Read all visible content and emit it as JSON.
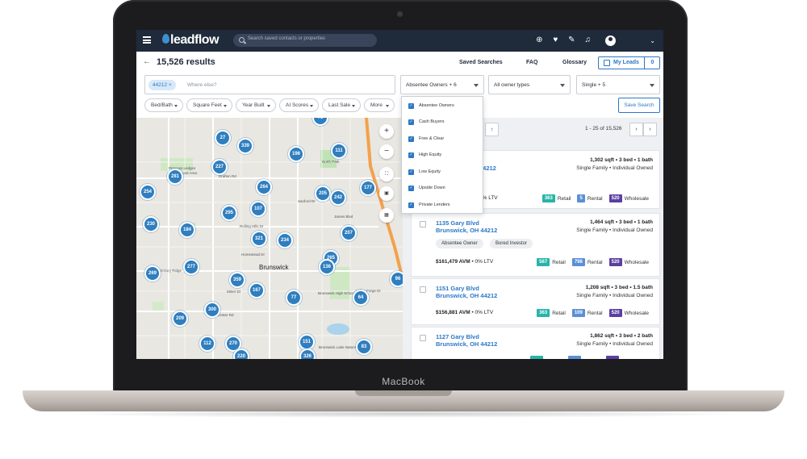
{
  "device": {
    "brand_label": "MacBook"
  },
  "nav": {
    "logo": "leadflow",
    "search_placeholder": "Search saved contacts or properties",
    "icons": [
      "plus-circle-icon",
      "heart-icon",
      "pin-icon",
      "bell-icon",
      "user-avatar-icon",
      "chevron-down-icon"
    ]
  },
  "header": {
    "results": "15,526 results",
    "links": [
      "Saved Searches",
      "FAQ",
      "Glossary"
    ],
    "my_leads": "My Leads",
    "my_leads_count": "0"
  },
  "filters": {
    "location_chip": "44212",
    "location_placeholder": "Where else?",
    "owner_select": "Absentee Owners + 6",
    "owner_type_select": "All owner types",
    "property_select": "Single + 5",
    "pills": [
      "Bed/Bath",
      "Square Feet",
      "Year Built",
      "AI Scores",
      "Last Sale",
      "More"
    ],
    "save_search": "Save Search"
  },
  "dropdown": {
    "items": [
      {
        "label": "Absentee Owners",
        "checked": true
      },
      {
        "label": "Cash Buyers",
        "checked": true
      },
      {
        "label": "Free & Clear",
        "checked": true
      },
      {
        "label": "High Equity",
        "checked": true
      },
      {
        "label": "Low Equity",
        "checked": true
      },
      {
        "label": "Upside Down",
        "checked": true
      },
      {
        "label": "Private Lenders",
        "checked": true
      }
    ]
  },
  "map": {
    "city": "Brunswick",
    "clusters": [
      "75",
      "27",
      "339",
      "196",
      "111",
      "281",
      "227",
      "254",
      "264",
      "205",
      "242",
      "177",
      "107",
      "295",
      "230",
      "184",
      "321",
      "234",
      "207",
      "277",
      "265",
      "136",
      "269",
      "359",
      "167",
      "77",
      "64",
      "96",
      "300",
      "209",
      "112",
      "270",
      "151",
      "83",
      "220",
      "326"
    ],
    "streets": [
      "Marks Rd",
      "Drafton Rd",
      "Princess Ledges",
      "Natural Area",
      "Sanford Dr",
      "Trails",
      "Rolling Hills Dr",
      "James Blvd",
      "Carpenter Rd",
      "Homestead Dr",
      "Center Rd",
      "Hickory Ridge",
      "Miner Dr",
      "Pearl Rd",
      "Valley Forge Dr",
      "Brunswick High School",
      "Brunswick Lake Nature Pres.",
      "North Park"
    ],
    "controls": [
      "zoom-in-icon",
      "zoom-out-icon",
      "expand-icon",
      "trash-icon",
      "layers-icon"
    ]
  },
  "list": {
    "page_range": "1 - 25 of 15,526",
    "cards": [
      {
        "address1": "",
        "address2": "44212",
        "specs": "1,302 sqft • 3 bed • 1 bath",
        "ptype": "Single Family • Individual Owned",
        "tags": [],
        "avm": "",
        "ltv": "0% LTV",
        "retail": "363",
        "retail_label": "Retail",
        "rental": "5",
        "rental_label": "Rental",
        "wholesale": "520",
        "wholesale_label": "Wholesale"
      },
      {
        "address1": "1135 Gary Blvd",
        "address2": "Brunswick, OH 44212",
        "specs": "1,464 sqft • 3 bed • 1 bath",
        "ptype": "Single Family • Individual Owned",
        "tags": [
          "Absentee Owner",
          "Bored Investor"
        ],
        "avm": "$161,479 AVM",
        "ltv": "• 0% LTV",
        "retail": "567",
        "retail_label": "Retail",
        "rental": "798",
        "rental_label": "Rental",
        "wholesale": "520",
        "wholesale_label": "Wholesale"
      },
      {
        "address1": "1151 Gary Blvd",
        "address2": "Brunswick, OH 44212",
        "specs": "1,208 sqft • 3 bed • 1.5 bath",
        "ptype": "Single Family • Individual Owned",
        "tags": [],
        "avm": "$156,881 AVM",
        "ltv": "• 0% LTV",
        "retail": "363",
        "retail_label": "Retail",
        "rental": "109",
        "rental_label": "Rental",
        "wholesale": "520",
        "wholesale_label": "Wholesale"
      },
      {
        "address1": "1127 Gary Blvd",
        "address2": "Brunswick, OH 44212",
        "specs": "1,862 sqft • 3 bed • 2 bath",
        "ptype": "Single Family • Individual Owned"
      }
    ]
  },
  "colors": {
    "nav_bg": "#1f2a3a",
    "accent": "#2c78c7",
    "cluster": "#2f7ebf",
    "retail": "#26b5a8",
    "rental": "#5b8fd6",
    "wholesale": "#5b3fa0"
  }
}
